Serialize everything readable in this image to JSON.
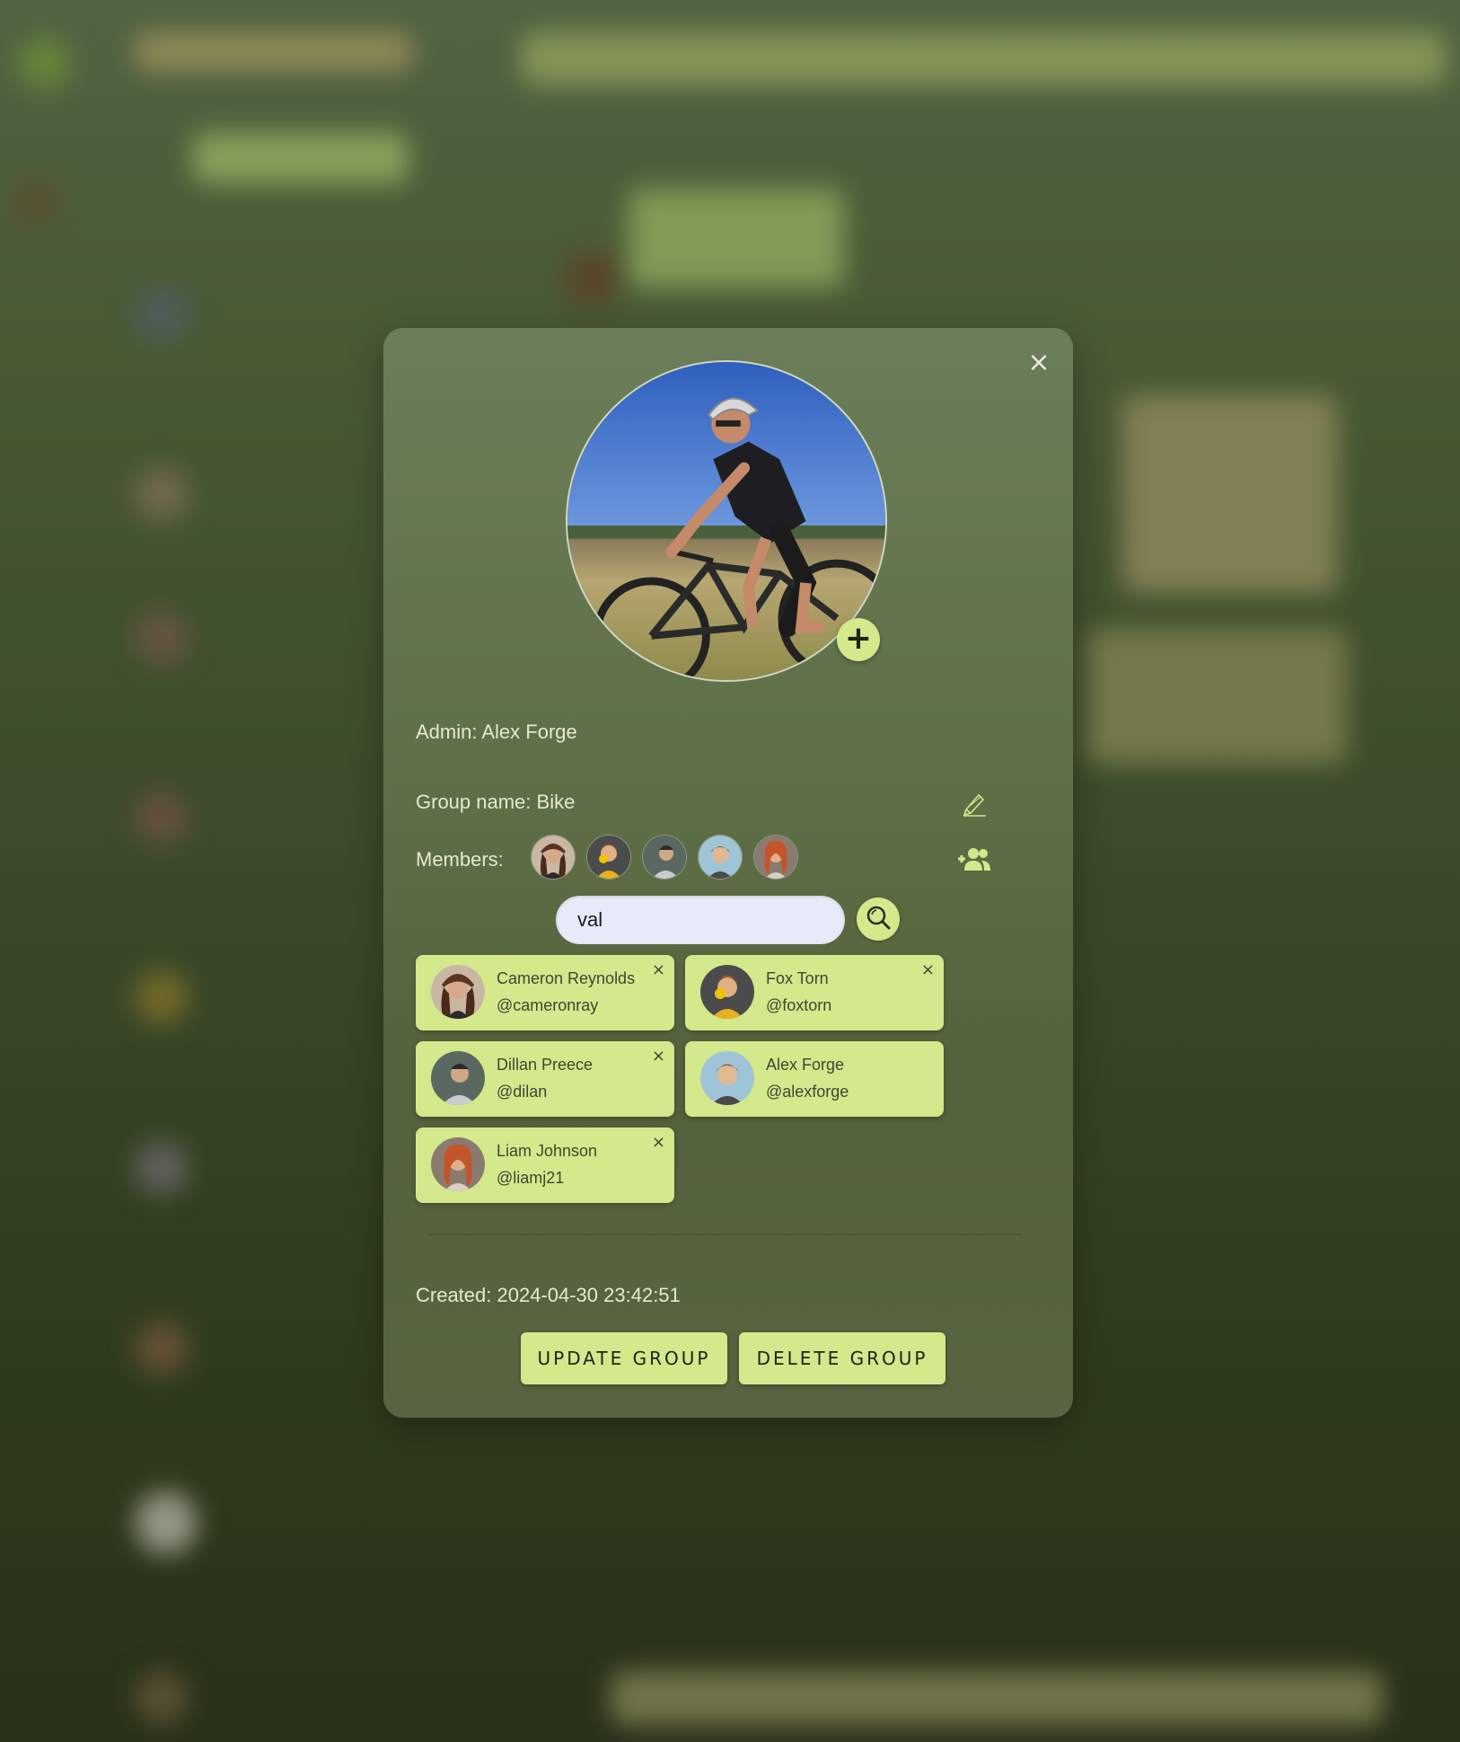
{
  "modal": {
    "close_label": "×",
    "add_photo_label": "+",
    "admin_text": "Admin: Alex Forge",
    "group_name_text": "Group name: Bike",
    "members_label": "Members:",
    "search": {
      "value": "val"
    },
    "created_text": "Created: 2024-04-30 23:42:51",
    "update_label": "UPDATE GROUP",
    "delete_label": "DELETE GROUP"
  },
  "members": [
    {
      "name": "Cameron Reynolds",
      "handle": "@cameronray",
      "removable": true
    },
    {
      "name": "Fox Torn",
      "handle": "@foxtorn",
      "removable": true
    },
    {
      "name": "Dillan Preece",
      "handle": "@dilan",
      "removable": true
    },
    {
      "name": "Alex Forge",
      "handle": "@alexforge",
      "removable": false
    },
    {
      "name": "Liam Johnson",
      "handle": "@liamj21",
      "removable": true
    }
  ],
  "remove_label": "×",
  "icons": {
    "close": "close-icon",
    "edit": "pencil-icon",
    "add_member": "user-plus-icon",
    "search": "search-icon",
    "add_photo": "plus-icon"
  },
  "colors": {
    "accent": "#d4e88c",
    "modal_bg": "#627349",
    "text_light": "#e4e9d4",
    "card_text": "#3e4632"
  }
}
